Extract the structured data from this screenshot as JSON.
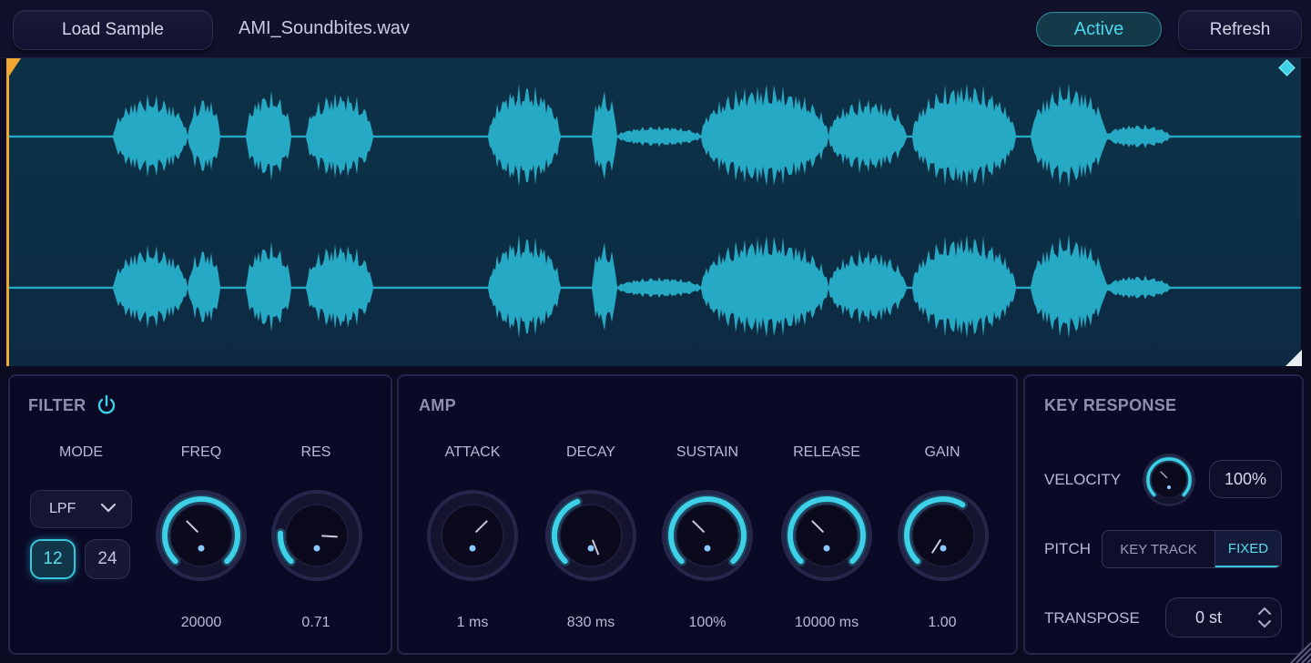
{
  "topbar": {
    "load_label": "Load Sample",
    "filename": "AMI_Soundbites.wav",
    "active_label": "Active",
    "refresh_label": "Refresh"
  },
  "colors": {
    "accent": "#3ed0e6",
    "marker": "#f0a830",
    "waveform": "#25a9c4",
    "panel_bg": "#0a0a26"
  },
  "filter": {
    "title": "FILTER",
    "mode_label": "MODE",
    "mode_value": "LPF",
    "slopes": [
      {
        "label": "12",
        "active": true
      },
      {
        "label": "24",
        "active": false
      }
    ],
    "knobs": [
      {
        "label": "FREQ",
        "value": "20000",
        "level": 1.0
      },
      {
        "label": "RES",
        "value": "0.71",
        "level": 0.18
      }
    ]
  },
  "amp": {
    "title": "AMP",
    "knobs": [
      {
        "label": "ATTACK",
        "value": "1 ms",
        "level": 0.0
      },
      {
        "label": "DECAY",
        "value": "830 ms",
        "level": 0.42
      },
      {
        "label": "SUSTAIN",
        "value": "100%",
        "level": 1.0
      },
      {
        "label": "RELEASE",
        "value": "10000 ms",
        "level": 1.0
      },
      {
        "label": "GAIN",
        "value": "1.00",
        "level": 0.62
      }
    ]
  },
  "key": {
    "title": "KEY RESPONSE",
    "velocity_label": "VELOCITY",
    "velocity_value": "100%",
    "velocity_level": 1.0,
    "pitch_label": "PITCH",
    "pitch_options": [
      "KEY TRACK",
      "FIXED"
    ],
    "pitch_selected": "FIXED",
    "transpose_label": "TRANSPOSE",
    "transpose_value": "0 st"
  }
}
